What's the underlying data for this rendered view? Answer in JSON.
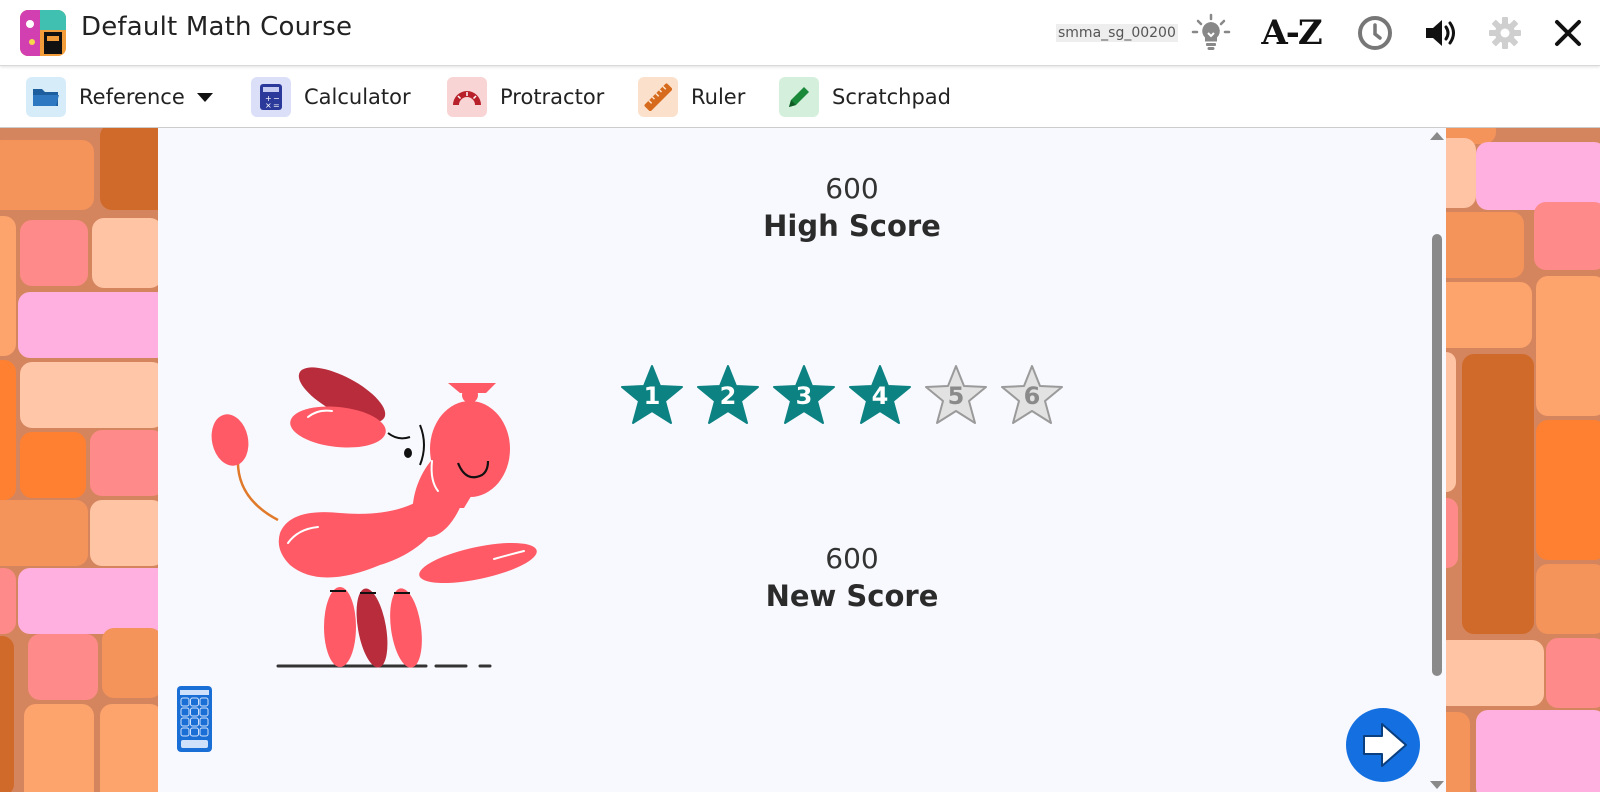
{
  "header": {
    "course_title": "Default Math Course",
    "user_id": "smma_sg_00200",
    "icons": [
      "lightbulb-icon",
      "glossary-az-icon",
      "timer-icon",
      "volume-icon",
      "settings-icon",
      "close-icon"
    ],
    "glossary_label": "A-Z"
  },
  "toolbar": {
    "reference_label": "Reference",
    "calculator_label": "Calculator",
    "protractor_label": "Protractor",
    "ruler_label": "Ruler",
    "scratchpad_label": "Scratchpad"
  },
  "results": {
    "high_score_value": "600",
    "high_score_label": "High Score",
    "new_score_value": "600",
    "new_score_label": "New Score",
    "stars": [
      {
        "label": "1",
        "earned": true
      },
      {
        "label": "2",
        "earned": true
      },
      {
        "label": "3",
        "earned": true
      },
      {
        "label": "4",
        "earned": true
      },
      {
        "label": "5",
        "earned": false
      },
      {
        "label": "6",
        "earned": false
      }
    ]
  },
  "colors": {
    "star_earned": "#0d8282",
    "star_unearned": "#e2e2e2",
    "next_button": "#1470e0",
    "balloon_dog": "#ff5a66",
    "balloon_dog_dark": "#b82c3b"
  }
}
